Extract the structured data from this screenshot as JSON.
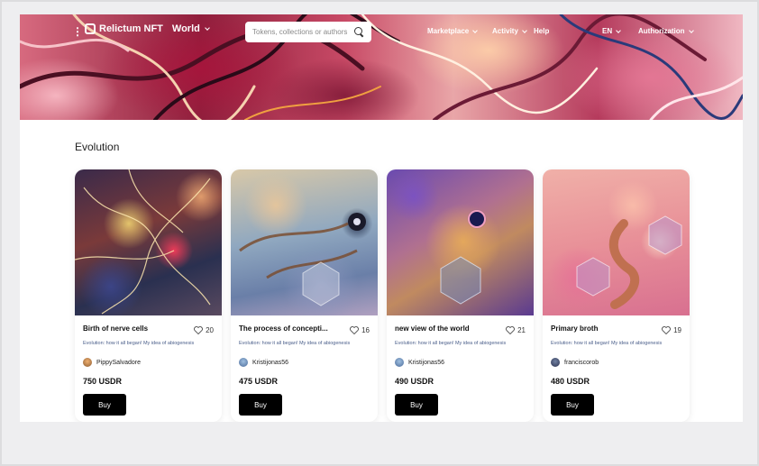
{
  "header": {
    "menu_glyph": "⋮",
    "logo_text": "Relictum NFT",
    "logo_world": "World",
    "search_placeholder": "Tokens, collections or authors",
    "nav": [
      {
        "label": "Marketplace"
      },
      {
        "label": "Activity"
      },
      {
        "label": "Help"
      },
      {
        "label": "EN"
      },
      {
        "label": "Authorization"
      }
    ]
  },
  "section": {
    "title": "Evolution"
  },
  "cards": [
    {
      "title": "Birth of nerve cells",
      "likes": "20",
      "description": "Evolution: how it all began! My idea of abiogenesis",
      "author": "PippySalvadore",
      "price": "750 USDR",
      "buy_label": "Buy"
    },
    {
      "title": "The process of concepti...",
      "likes": "16",
      "description": "Evolution: how it all began! My idea of abiogenesis",
      "author": "Kristijonas56",
      "price": "475 USDR",
      "buy_label": "Buy"
    },
    {
      "title": "new view of the world",
      "likes": "21",
      "description": "Evolution: how it all began! My idea of abiogenesis",
      "author": "Kristijonas56",
      "price": "490 USDR",
      "buy_label": "Buy"
    },
    {
      "title": "Primary broth",
      "likes": "19",
      "description": "Evolution: how it all began! My idea of abiogenesis",
      "author": "franciscorob",
      "price": "480 USDR",
      "buy_label": "Buy"
    }
  ],
  "colors": {
    "accent": "#000000",
    "desc_text": "#4a5e8a",
    "hero": "#c84a66"
  }
}
